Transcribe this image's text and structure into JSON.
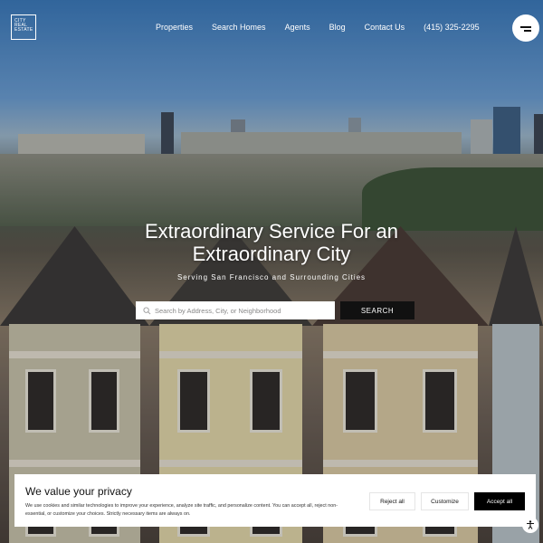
{
  "logo": {
    "lines": [
      "CITY",
      "REAL",
      "ESTATE"
    ]
  },
  "nav": {
    "items": [
      "Properties",
      "Search Homes",
      "Agents",
      "Blog",
      "Contact Us",
      "(415) 325-2295"
    ]
  },
  "hero": {
    "title_line1": "Extraordinary Service For an",
    "title_line2": "Extraordinary City",
    "subtitle": "Serving San Francisco and Surrounding Cities",
    "search_placeholder": "Search by Address, City, or Neighborhood",
    "search_button": "SEARCH"
  },
  "cookie": {
    "title": "We value your privacy",
    "text": "We use cookies and similar technologies to improve your experience, analyze site traffic, and personalize content. You can accept all, reject non-essential, or customize your choices. Strictly necessary items are always on.",
    "reject": "Reject all",
    "customize": "Customize",
    "accept": "Accept all"
  },
  "icons": {
    "menu": "hamburger-icon",
    "search": "search-icon",
    "accessibility": "accessibility-icon"
  }
}
